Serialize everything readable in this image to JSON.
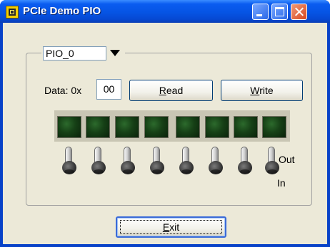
{
  "window": {
    "title": "PCIe Demo PIO",
    "controls": {
      "minimize_icon": "minimize-icon",
      "maximize_icon": "maximize-icon",
      "close_icon": "close-icon"
    }
  },
  "port_select": {
    "selected": "PIO_0"
  },
  "data_field": {
    "label": "Data: 0x",
    "value": "00"
  },
  "buttons": {
    "read": {
      "mnemonic": "R",
      "rest": "ead"
    },
    "write": {
      "mnemonic": "W",
      "rest": "rite"
    },
    "exit": {
      "mnemonic": "E",
      "rest": "xit"
    }
  },
  "io": {
    "leds": [
      "off",
      "off",
      "off",
      "off",
      "off",
      "off",
      "off",
      "off"
    ],
    "switches": [
      "up",
      "up",
      "up",
      "up",
      "up",
      "up",
      "up",
      "up"
    ],
    "out_label": "Out",
    "in_label": "In"
  },
  "colors": {
    "titlebar": "#0654e4",
    "led_off": "#164016",
    "client_bg": "#ece9d8",
    "close_button": "#d84820"
  }
}
